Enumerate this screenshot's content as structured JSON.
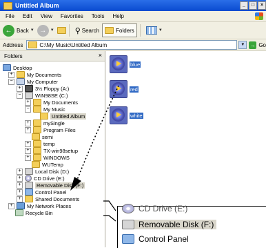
{
  "window": {
    "title": "Untitled Album",
    "buttons": [
      "_",
      "□",
      "×"
    ]
  },
  "menu": [
    "File",
    "Edit",
    "View",
    "Favorites",
    "Tools",
    "Help"
  ],
  "toolbar": {
    "back": "Back",
    "search": "Search",
    "folders": "Folders"
  },
  "address": {
    "label": "Address",
    "value": "C:\\My Music\\Untitled Album",
    "go": "Go"
  },
  "folders_pane": {
    "title": "Folders",
    "close": "×",
    "nodes": [
      {
        "label": "Desktop",
        "pm": ""
      },
      {
        "label": "My Documents",
        "pm": "+"
      },
      {
        "label": "My Computer",
        "pm": "−"
      },
      {
        "label": "3½ Floppy (A:)",
        "pm": "+"
      },
      {
        "label": "WIN98SE (C:)",
        "pm": "−"
      },
      {
        "label": "My Documents",
        "pm": "+"
      },
      {
        "label": "My Music",
        "pm": "−"
      },
      {
        "label": "Untitled Album",
        "pm": ""
      },
      {
        "label": "mySingle",
        "pm": "+"
      },
      {
        "label": "Program Files",
        "pm": "+"
      },
      {
        "label": "semi",
        "pm": ""
      },
      {
        "label": "temp",
        "pm": "+"
      },
      {
        "label": "TX-win98setup",
        "pm": "+"
      },
      {
        "label": "WINDOWS",
        "pm": "+"
      },
      {
        "label": "WUTemp",
        "pm": ""
      },
      {
        "label": "Local Disk (D:)",
        "pm": "+"
      },
      {
        "label": "CD Drive (E:)",
        "pm": "+"
      },
      {
        "label": "Removable Disk (F:)",
        "pm": "+"
      },
      {
        "label": "Control Panel",
        "pm": "+"
      },
      {
        "label": "Shared Documents",
        "pm": "+"
      },
      {
        "label": "My Network Places",
        "pm": "+"
      },
      {
        "label": "Recycle Bin",
        "pm": ""
      }
    ]
  },
  "files": [
    {
      "name": "blue"
    },
    {
      "name": "red"
    },
    {
      "name": "white"
    }
  ],
  "zoom": {
    "items": [
      {
        "label": "CD Drive (E:)"
      },
      {
        "label": "Removable Disk (F:)"
      },
      {
        "label": "Control Panel"
      }
    ]
  }
}
